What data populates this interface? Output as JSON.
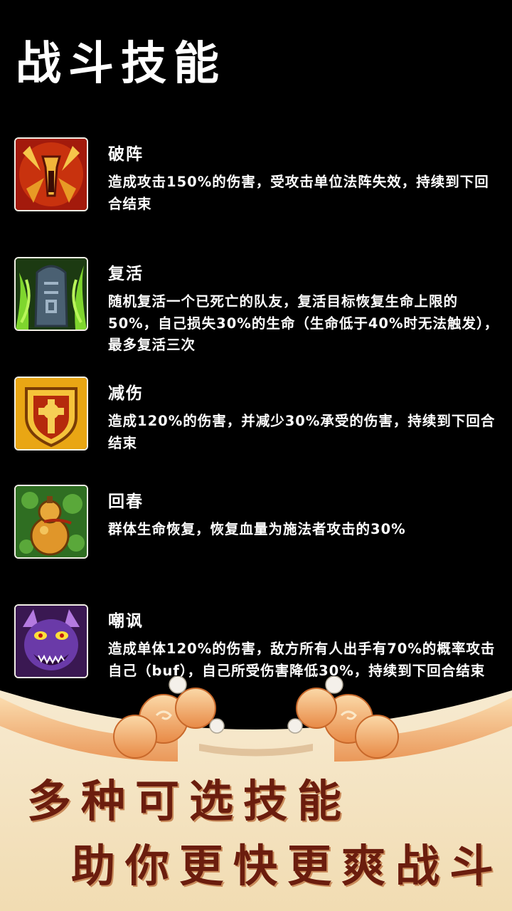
{
  "title": "战斗技能",
  "skills": [
    {
      "name": "破阵",
      "icon": "broken-formation-icon",
      "description": "造成攻击150%的伤害，受攻击单位法阵失效，持续到下回合结束"
    },
    {
      "name": "复活",
      "icon": "revive-tombstone-icon",
      "description": "随机复活一个已死亡的队友，复活目标恢复生命上限的50%，自己损失30%的生命（生命低于40%时无法触发），最多复活三次"
    },
    {
      "name": "减伤",
      "icon": "shield-cross-icon",
      "description": "造成120%的伤害，并减少30%承受的伤害，持续到下回合结束"
    },
    {
      "name": "回春",
      "icon": "gourd-icon",
      "description": "群体生命恢复，恢复血量为施法者攻击的30%"
    },
    {
      "name": "嘲讽",
      "icon": "demon-face-icon",
      "description": "造成单体120%的伤害，敌方所有人出手有70%的概率攻击自己（buf），自己所受伤害降低30%，持续到下回合结束"
    }
  ],
  "slogan": {
    "line1": "多种可选技能",
    "line2": "助你更快更爽战斗"
  },
  "colors": {
    "background": "#000000",
    "text": "#ffffff",
    "slogan": "#6b1d0e",
    "banner": "#f3e2c0"
  }
}
